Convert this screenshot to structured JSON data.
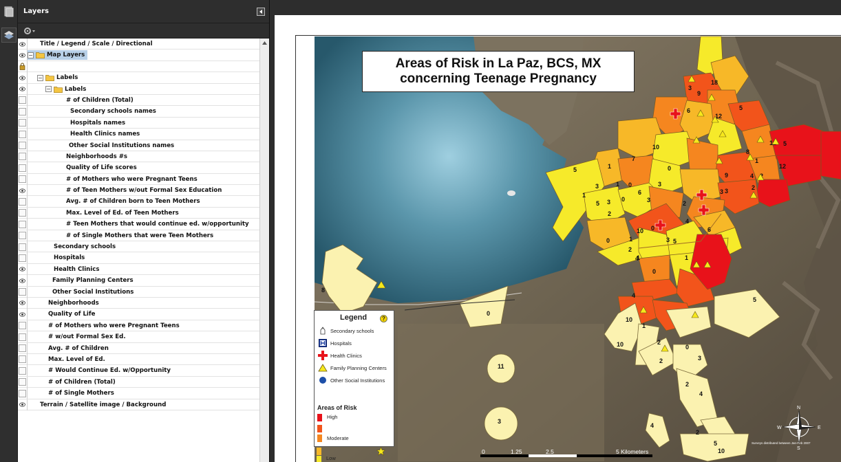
{
  "panel": {
    "title": "Layers"
  },
  "layers": [
    {
      "label": "Title / Legend / Scale / Directional",
      "indent": 32,
      "visible": true,
      "toggle": "",
      "folder": false
    },
    {
      "label": "Map Layers",
      "indent": 14,
      "visible": true,
      "toggle": "−",
      "folder": true,
      "selected": true
    },
    {
      "label": "",
      "indent": 20,
      "visible": false,
      "toggle": "",
      "folder": false,
      "lock": true
    },
    {
      "label": "Labels",
      "indent": 28,
      "visible": true,
      "toggle": "−",
      "folder": true
    },
    {
      "label": "Labels",
      "indent": 40,
      "visible": true,
      "toggle": "−",
      "folder": true
    },
    {
      "label": "# of Children (Total)",
      "indent": 70,
      "visible": false
    },
    {
      "label": "Secondary schools names",
      "indent": 76,
      "visible": false
    },
    {
      "label": "Hospitals names",
      "indent": 76,
      "visible": false
    },
    {
      "label": "Health Clinics names",
      "indent": 76,
      "visible": false
    },
    {
      "label": "Other Social Institutions names",
      "indent": 74,
      "visible": false
    },
    {
      "label": "Neighborhoods #s",
      "indent": 70,
      "visible": false
    },
    {
      "label": "Quality of Life scores",
      "indent": 70,
      "visible": false
    },
    {
      "label": "# of Mothers who were Pregnant Teens",
      "indent": 70,
      "visible": false
    },
    {
      "label": "# of Teen Mothers w/out Formal Sex Education",
      "indent": 70,
      "visible": true
    },
    {
      "label": "Avg. # of Children born to Teen Mothers",
      "indent": 70,
      "visible": false
    },
    {
      "label": "Max. Level of Ed. of Teen Mothers",
      "indent": 70,
      "visible": false
    },
    {
      "label": "# Teen Mothers that would continue ed. w/opportunity",
      "indent": 70,
      "visible": false
    },
    {
      "label": "# of Single Mothers  that were Teen Mothers",
      "indent": 70,
      "visible": false
    },
    {
      "label": "Secondary schools",
      "indent": 52,
      "visible": false
    },
    {
      "label": "Hospitals",
      "indent": 52,
      "visible": false
    },
    {
      "label": "Health Clinics",
      "indent": 52,
      "visible": true
    },
    {
      "label": "Family Planning Centers",
      "indent": 50,
      "visible": true
    },
    {
      "label": "Other Social Institutions",
      "indent": 50,
      "visible": false
    },
    {
      "label": "Neighborhoods",
      "indent": 44,
      "visible": true
    },
    {
      "label": "Quality of Life",
      "indent": 44,
      "visible": true
    },
    {
      "label": "# of Mothers who were Pregnant Teens",
      "indent": 44,
      "visible": false
    },
    {
      "label": "# w/out Formal Sex Ed.",
      "indent": 44,
      "visible": false
    },
    {
      "label": "Avg. # of Children",
      "indent": 44,
      "visible": false
    },
    {
      "label": "Max. Level of Ed.",
      "indent": 44,
      "visible": false
    },
    {
      "label": "# Would Continue Ed. w/Opportunity",
      "indent": 44,
      "visible": false
    },
    {
      "label": "# of Children (Total)",
      "indent": 44,
      "visible": false
    },
    {
      "label": "# of Single Mothers",
      "indent": 44,
      "visible": false
    },
    {
      "label": "Terrain / Satellite image / Background",
      "indent": 32,
      "visible": true
    }
  ],
  "map": {
    "title_line1": "Areas of Risk in La Paz, BCS, MX",
    "title_line2": "concerning Teenage Pregnancy",
    "legend": {
      "title": "Legend",
      "help": "?",
      "items": [
        {
          "label": "Secondary schools",
          "icon": "school-icon"
        },
        {
          "label": "Hospitals",
          "icon": "hospital-icon"
        },
        {
          "label": "Health Clinics",
          "icon": "red-cross-icon"
        },
        {
          "label": "Family Planning Centers",
          "icon": "yellow-triangle-icon"
        },
        {
          "label": "Other Social Institutions",
          "icon": "blue-dot-icon"
        }
      ],
      "risk_title": "Areas of Risk",
      "risk_high": "High",
      "risk_moderate": "Moderate",
      "risk_low": "Low",
      "risk_colors": [
        "#e8121a",
        "#f2541b",
        "#f5861f",
        "#f7b828",
        "#f6ea2a"
      ]
    },
    "scale": {
      "t0": "0",
      "t1": "1.25",
      "t2": "2.5",
      "t3": "5 Kilometers"
    },
    "credit": "Surveys distributed between Jan-Feb 2007",
    "numbers": [
      "18",
      "9",
      "3",
      "5",
      "6",
      "12",
      "12",
      "5",
      "10",
      "7",
      "8",
      "1",
      "12",
      "5",
      "1",
      "0",
      "9",
      "4",
      "2",
      "3",
      "2",
      "3",
      "1",
      "0",
      "6",
      "3",
      "3",
      "1",
      "5",
      "3",
      "0",
      "2",
      "2",
      "3",
      "10",
      "0",
      "4",
      "6",
      "1",
      "3",
      "5",
      "0",
      "1",
      "2",
      "4",
      "0",
      "1",
      "4",
      "8",
      "0",
      "5",
      "10",
      "1",
      "10",
      "2",
      "0",
      "2",
      "3",
      "2",
      "4",
      "11",
      "3",
      "4",
      "2",
      "5",
      "10"
    ],
    "compass": {
      "n": "N",
      "s": "S",
      "e": "E",
      "w": "W"
    }
  }
}
